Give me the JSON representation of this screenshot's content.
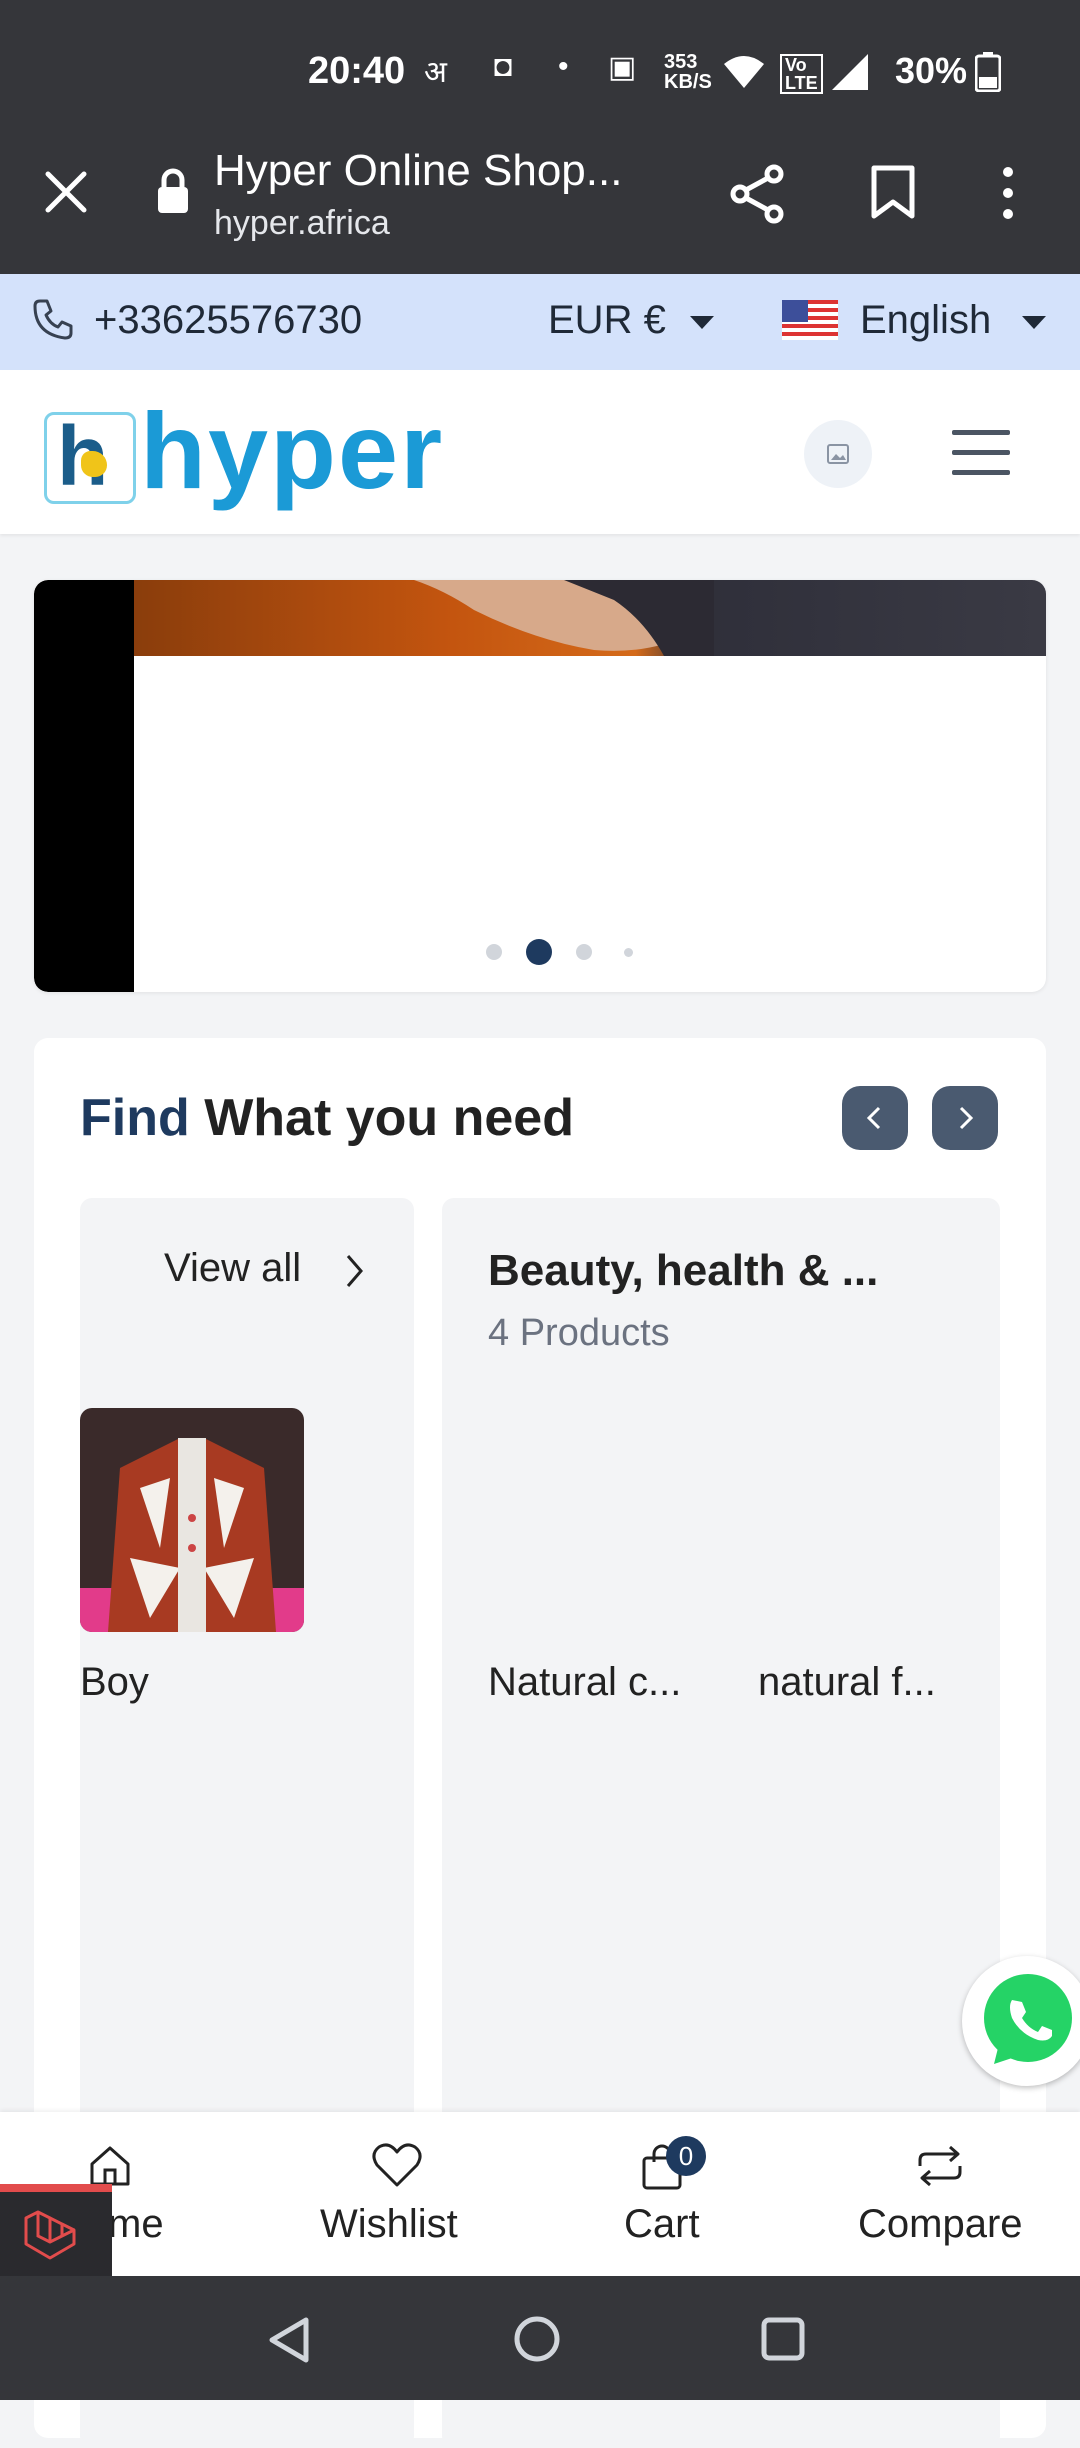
{
  "status_bar": {
    "time": "20:40",
    "net_speed_top": "353",
    "net_speed_bottom": "KB/S",
    "battery": "30%"
  },
  "browser": {
    "title": "Hyper Online Shop...",
    "url": "hyper.africa"
  },
  "topbar": {
    "phone": "+33625576730",
    "currency": "EUR €",
    "language": "English"
  },
  "header": {
    "logo_text": "hyper"
  },
  "banner": {
    "slide_count": 4,
    "active_slide": 2
  },
  "categories": {
    "title_accent": "Find",
    "title_rest": "What you need",
    "cards": [
      {
        "view_all": "View all",
        "item_label": "Boy"
      },
      {
        "name": "Beauty, health & ...",
        "count": "4 Products",
        "items": [
          "Natural c...",
          "natural f..."
        ]
      }
    ]
  },
  "bottom_nav": {
    "home": "me",
    "wishlist": "Wishlist",
    "cart": "Cart",
    "cart_count": "0",
    "compare": "Compare"
  },
  "colors": {
    "accent": "#1e3a5f",
    "topbar_bg": "#d4e2fb",
    "chrome_bg": "#35363a",
    "logo_blue": "#1b9ad6",
    "whatsapp": "#25d366",
    "laravel_red": "#c93a3a"
  }
}
